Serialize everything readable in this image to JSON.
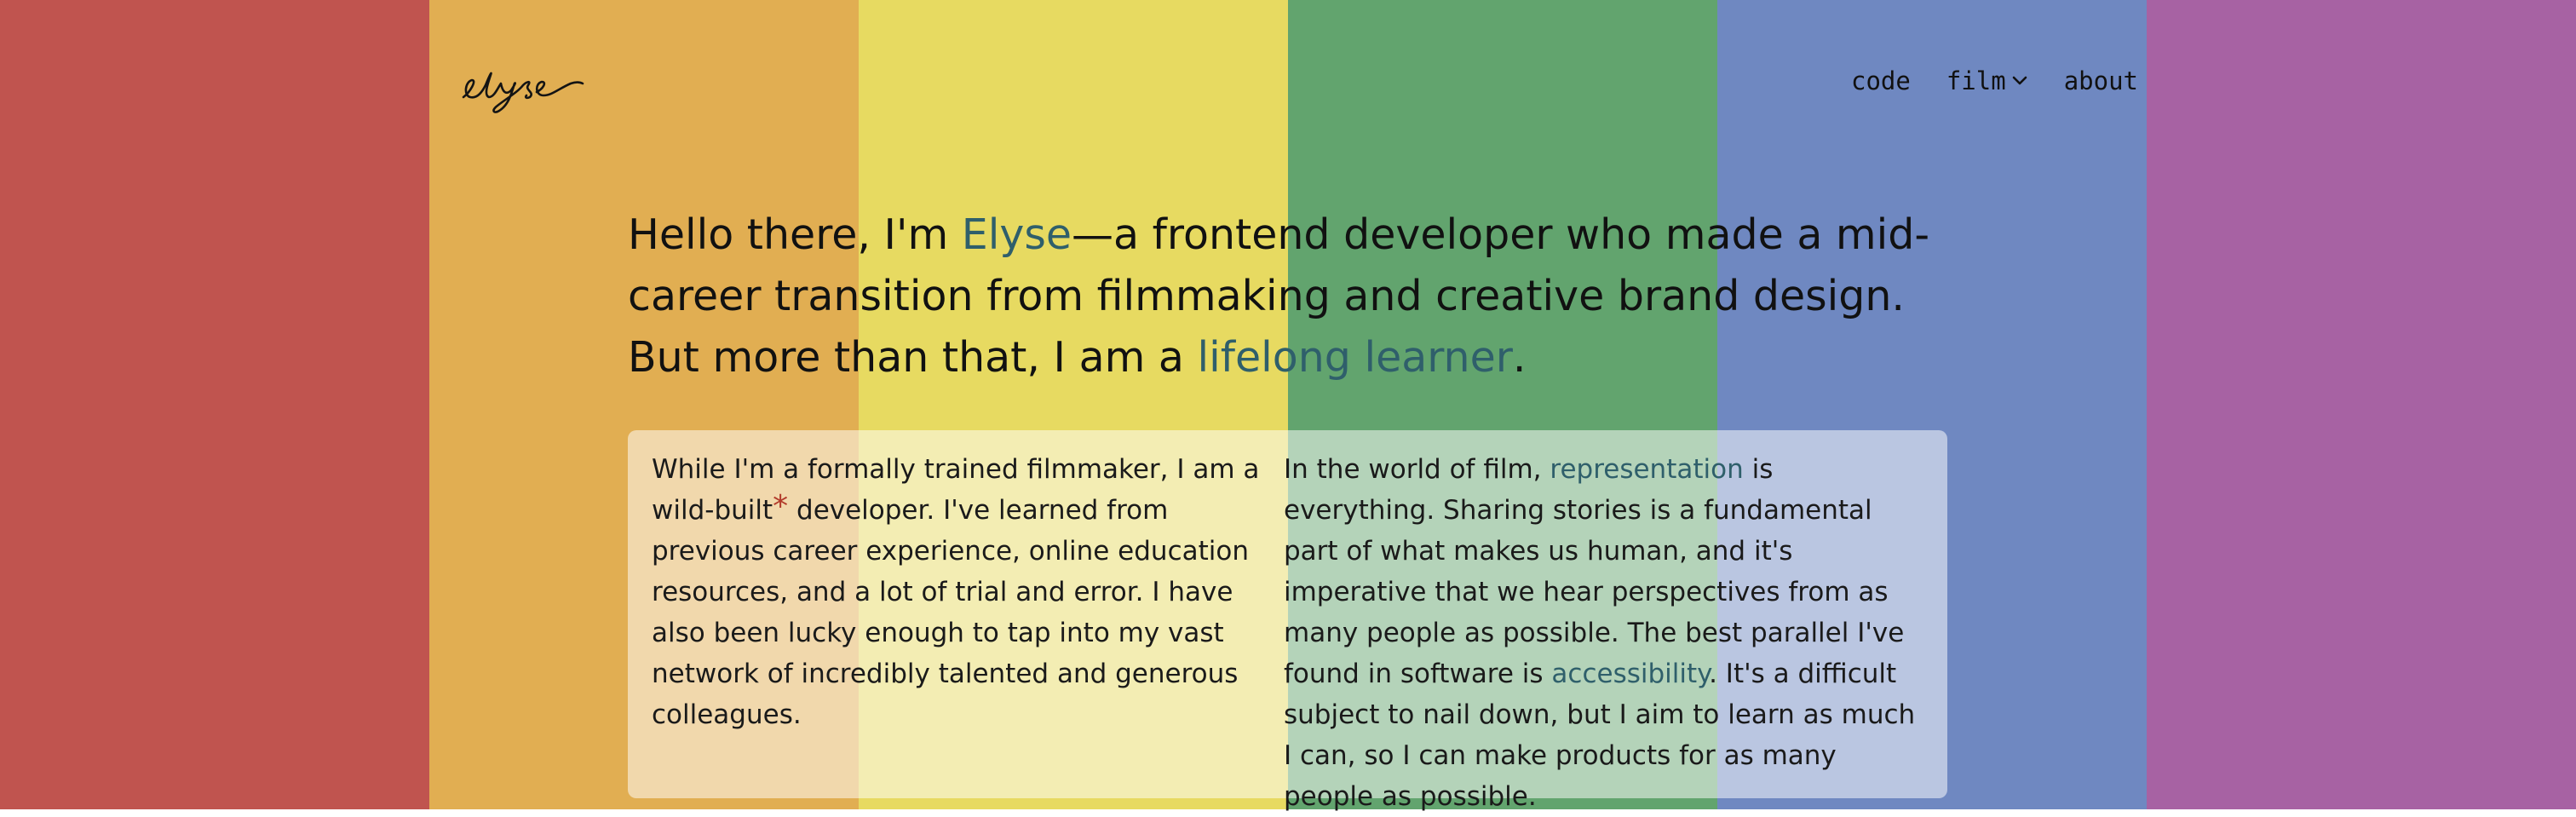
{
  "colors": {
    "stripes": [
      "#c0544f",
      "#e1ae52",
      "#e7da61",
      "#62a46e",
      "#6f88c1",
      "#a762a3"
    ],
    "highlight": "#2f5f6b",
    "asterisk": "#b23a2a"
  },
  "logo": {
    "icon": "elyse-signature-logo"
  },
  "nav": {
    "code": "code",
    "film": "film",
    "about": "about"
  },
  "hero": {
    "part1": "Hello there, I'm ",
    "name": "Elyse",
    "part2": "—a frontend developer who made a mid-career transition from filmmaking and creative brand design. But more than that, I am a ",
    "learner": "lifelong learner",
    "part3": "."
  },
  "card": {
    "left": {
      "a": "While I'm a formally trained filmmaker, I am a wild-built",
      "star": "*",
      "b": " developer. I've learned from previous career experience, online education resources, and a lot of trial and error. I have also been lucky enough to tap into my vast network of incredibly talented and generous colleagues."
    },
    "right": {
      "a": "In the world of film, ",
      "link1": "representation",
      "b": " is everything. Sharing stories is a fundamental part of what makes us human, and it's imperative that we hear perspectives from as many people as possible. The best parallel I've found in software is ",
      "link2": "accessibility",
      "c": ". It's a difficult subject to nail down, but I aim to learn as much I can, so I can make products for as many people as possible."
    }
  }
}
